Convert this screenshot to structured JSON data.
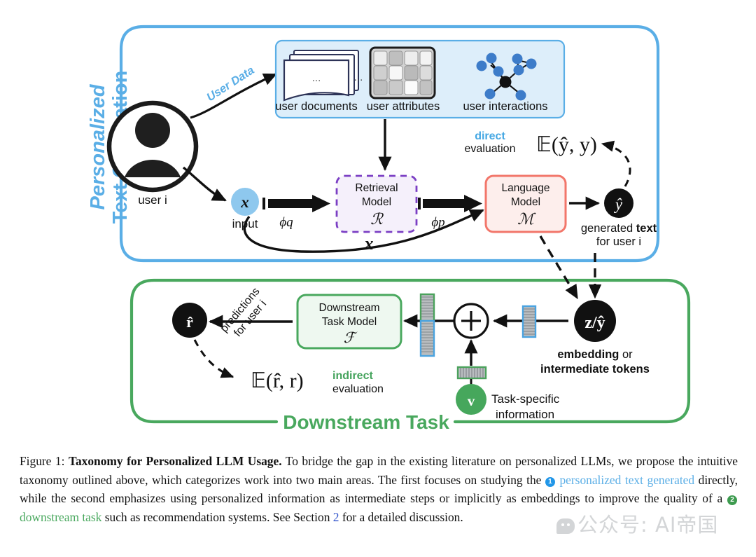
{
  "figure": {
    "top_panel": {
      "title": "Personalized\nText Generation",
      "title_line1": "Personalized",
      "title_line2": "Text Generation",
      "border_color": "#5aaee6",
      "user_label": "user i",
      "user_data_label": "User Data",
      "data_sources": [
        {
          "label": "user documents",
          "icon": "documents-stack-icon"
        },
        {
          "label": "user attributes",
          "icon": "table-grid-icon"
        },
        {
          "label": "user interactions",
          "icon": "graph-network-icon"
        }
      ],
      "input_node": "x",
      "input_label": "input",
      "edge_phi_q": "ϕq",
      "edge_phi_p": "ϕp",
      "bypass_label": "x",
      "retrieval_model": {
        "line1": "Retrieval",
        "line2": "Model",
        "symbol": "ℛ",
        "border_color": "#7b3fc4",
        "fill": "#f5f0fb"
      },
      "language_model": {
        "line1": "Language",
        "line2": "Model",
        "symbol": "ℳ",
        "border_color": "#f2766a",
        "fill": "#fdeeec"
      },
      "output_node": "ŷ",
      "output_label_bold": "text",
      "output_label_pre": "generated ",
      "output_label_line2": "for user i",
      "eval_label_bold": "direct",
      "eval_label_plain": "evaluation",
      "eval_formula": "𝔼(ŷ, y)"
    },
    "bottom_panel": {
      "title": "Downstream Task",
      "border_color": "#49a85e",
      "embedding_node": "z/ŷ",
      "embedding_label_line1_bold": "embedding",
      "embedding_label_line1_plain": " or",
      "embedding_label_line2": "intermediate tokens",
      "concat_symbol": "+",
      "task_vector_node": "v",
      "task_vector_label_line1": "Task-specific",
      "task_vector_label_line2": "information",
      "downstream_model": {
        "line1": "Downstream",
        "line2": "Task Model",
        "symbol": "ℱ",
        "border_color": "#49a85e",
        "fill": "#eef8f0"
      },
      "prediction_node": "r̂",
      "prediction_label_line1": "predictions",
      "prediction_label_line2": "for user i",
      "eval_formula": "𝔼(r̂, r)",
      "eval_label_bold": "indirect",
      "eval_label_plain": "evaluation"
    }
  },
  "caption": {
    "figure_number": "Figure 1:",
    "title": "Taxonomy for Personalized LLM Usage.",
    "body_1": "To bridge the gap in the existing literature on personalized LLMs, we propose the intuitive taxonomy outlined above, which categorizes work into two main areas. The first focuses on studying the",
    "badge_1": "1",
    "highlight_1": "personalized text generated",
    "body_2": "directly, while the second emphasizes using personalized information as intermediate steps or implicitly as embeddings to improve the quality of a",
    "badge_2": "2",
    "highlight_2": "downstream task",
    "body_3": "such as recommendation systems. See Section",
    "section_link": "2",
    "body_4": "for a detailed discussion."
  },
  "watermark": {
    "text": "公众号: AI帝国",
    "icon": "chat-bubble-icon"
  }
}
